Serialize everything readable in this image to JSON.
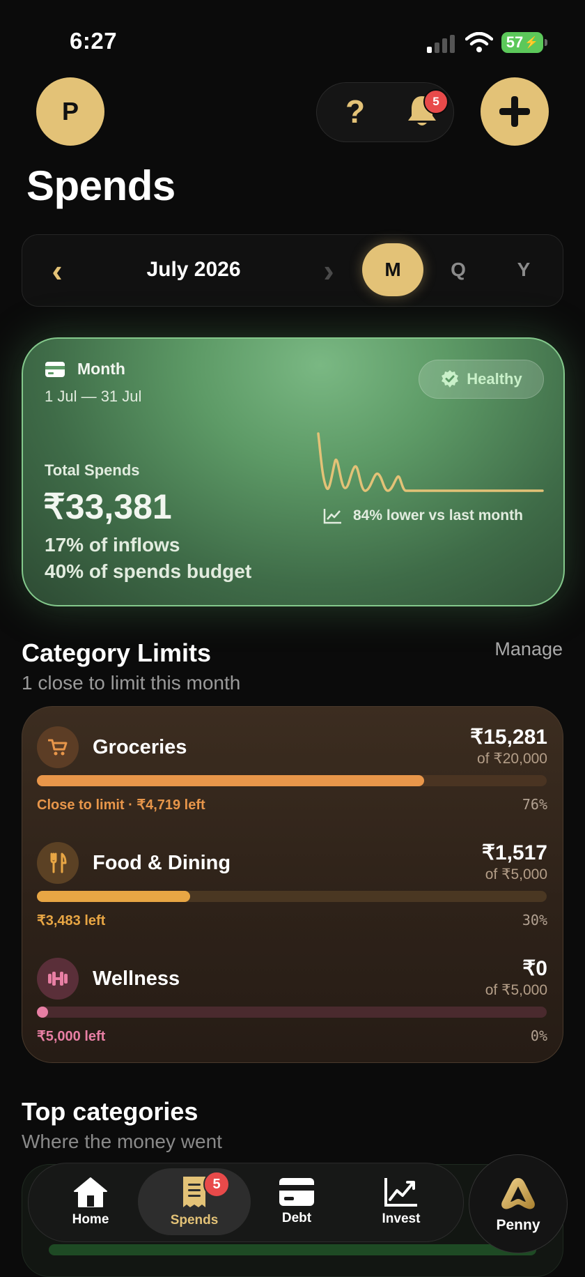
{
  "status_bar": {
    "time": "6:27",
    "battery": "57"
  },
  "header": {
    "avatar_initial": "P",
    "help_glyph": "?",
    "notification_count": "5",
    "add_glyph": "+"
  },
  "page": {
    "title": "Spends"
  },
  "period": {
    "label": "July 2026",
    "prev": "‹",
    "next": "›",
    "modes": [
      "M",
      "Q",
      "Y"
    ],
    "active_mode": "M"
  },
  "summary": {
    "period_name": "Month",
    "date_range": "1 Jul — 31 Jul",
    "status": "Healthy",
    "total_label": "Total Spends",
    "total_value": "₹33,381",
    "inflows_line": "17% of inflows",
    "budget_line": "40% of spends budget",
    "trend_text": "84% lower vs last month",
    "accent": "#e3c277"
  },
  "category_limits": {
    "title": "Category Limits",
    "subtitle": "1 close to limit this month",
    "manage_label": "Manage",
    "items": [
      {
        "name": "Groceries",
        "icon": "cart-icon",
        "amount": "₹15,281",
        "limit": "of ₹20,000",
        "status": "Close to limit · ₹4,719 left",
        "percent_label": "76%",
        "progress": 0.76,
        "color": "#e8964a",
        "track": "#4a3422",
        "icon_bg": "#5c3d25"
      },
      {
        "name": "Food & Dining",
        "icon": "fork-knife-icon",
        "amount": "₹1,517",
        "limit": "of ₹5,000",
        "status": "₹3,483 left",
        "percent_label": "30%",
        "progress": 0.3,
        "color": "#e8a644",
        "track": "#4a3722",
        "icon_bg": "#5b4124"
      },
      {
        "name": "Wellness",
        "icon": "dumbbell-icon",
        "amount": "₹0",
        "limit": "of ₹5,000",
        "status": "₹5,000 left",
        "percent_label": "0%",
        "progress": 0.0,
        "color": "#e87fa4",
        "track": "#4a2a2e",
        "icon_bg": "#5a2f39"
      }
    ]
  },
  "top_categories": {
    "title": "Top categories",
    "subtitle": "Where the money went"
  },
  "tabbar": {
    "tabs": [
      {
        "label": "Home",
        "icon": "home-icon"
      },
      {
        "label": "Spends",
        "icon": "receipt-icon",
        "badge": "5",
        "active": true
      },
      {
        "label": "Debt",
        "icon": "card-icon"
      },
      {
        "label": "Invest",
        "icon": "chart-icon"
      }
    ],
    "assistant_label": "Penny"
  }
}
